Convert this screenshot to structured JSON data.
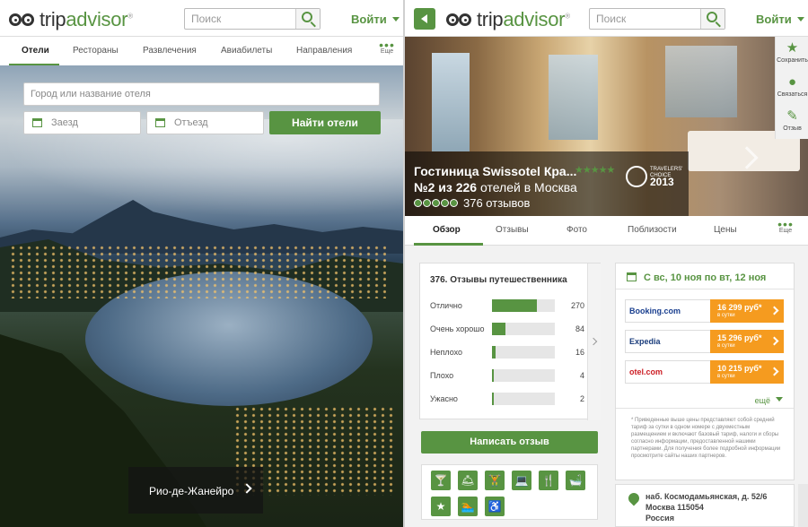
{
  "left": {
    "brand": {
      "trip": "trip",
      "advisor": "advisor",
      "registered": "®"
    },
    "search_placeholder": "Поиск",
    "login": "Войти",
    "tabs": [
      "Отели",
      "Рестораны",
      "Развлечения",
      "Авиабилеты",
      "Направления"
    ],
    "more": "Еще",
    "hotel_search": {
      "city_placeholder": "Город или название отеля",
      "checkin": "Заезд",
      "checkout": "Отъезд",
      "button": "Найти отели"
    },
    "destination_caption": "Рио-де-Жанейро"
  },
  "right": {
    "brand": {
      "trip": "trip",
      "advisor": "advisor",
      "registered": "®"
    },
    "search_placeholder": "Поиск",
    "login": "Войти",
    "sidebar": [
      {
        "icon": "star-icon",
        "label": "Сохранить"
      },
      {
        "icon": "person-icon",
        "label": "Связаться"
      },
      {
        "icon": "pencil-icon",
        "label": "Отзыв"
      }
    ],
    "hotel": {
      "name": "Гостиница Swissotel Кра...",
      "rank_prefix": "№2 из 226",
      "rank_suffix": " отелей в Москва",
      "stars": 5,
      "rating_bubbles": 5,
      "reviews": "376 отзывов",
      "award_line1": "TRAVELERS'",
      "award_line2": "CHOICE",
      "award_year": "2013"
    },
    "tabs": [
      "Обзор",
      "Отзывы",
      "Фото",
      "Поблизости",
      "Цены"
    ],
    "more": "Еще",
    "reviews_card": {
      "title": "376. Отзывы путешественника",
      "rows": [
        {
          "label": "Отлично",
          "count": "270",
          "share": 0.72
        },
        {
          "label": "Очень хорошо",
          "count": "84",
          "share": 0.22
        },
        {
          "label": "Неплохо",
          "count": "16",
          "share": 0.05
        },
        {
          "label": "Плохо",
          "count": "4",
          "share": 0.02
        },
        {
          "label": "Ужасно",
          "count": "2",
          "share": 0.01
        }
      ]
    },
    "write_review": "Написать отзыв",
    "amenities": [
      "🍸",
      "🛎",
      "🏋",
      "💻",
      "🍴",
      "🛁",
      "★",
      "🏊",
      "♿"
    ],
    "prices": {
      "dates": "С вс, 10 ноя по вт, 12 ноя",
      "vendors": [
        {
          "name": "Booking.com",
          "price": "16 299 руб*",
          "per": "в сутки",
          "color": "#1a3f8f"
        },
        {
          "name": "Expedia",
          "price": "15 296 руб*",
          "per": "в сутки",
          "color": "#1b3d7c"
        },
        {
          "name": "otel.com",
          "price": "10 215 руб*",
          "per": "в сутки",
          "color": "#cc1d24"
        }
      ],
      "more": "ещё",
      "disclaimer": "* Приведенные выше цены представляют собой средний тариф за сутки в одном номере с двухместным размещением и включают базовый тариф, налоги и сборы согласно информации, предоставленной нашими партнерами. Для получения более подробной информации просмотрите сайты наших партнеров."
    },
    "address": {
      "line1": "наб. Космодамьянская, д. 52/6",
      "line2": "Москва 115054",
      "line3": "Россия"
    }
  },
  "colors": {
    "accent": "#589442",
    "price": "#f59b1f"
  }
}
